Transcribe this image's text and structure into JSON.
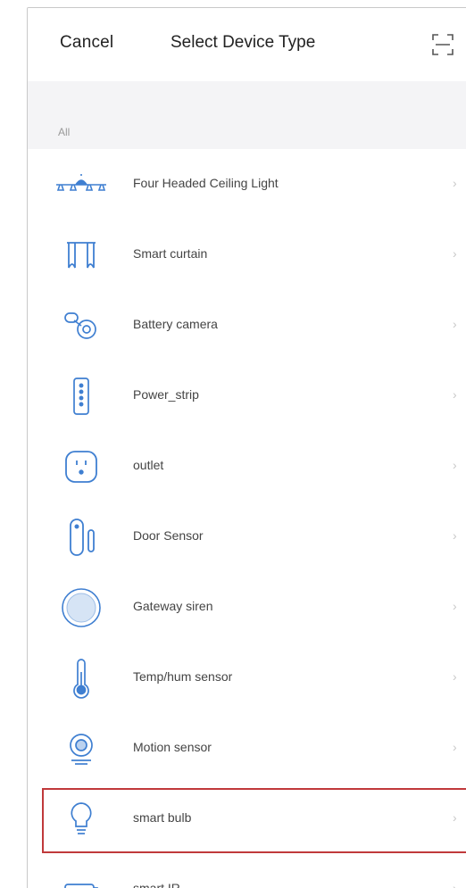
{
  "header": {
    "cancel_label": "Cancel",
    "title": "Select Device Type",
    "scan_icon": "scan-icon"
  },
  "section": {
    "label": "All"
  },
  "devices": [
    {
      "label": "Four Headed Ceiling Light",
      "icon": "ceiling-light-icon"
    },
    {
      "label": "Smart curtain",
      "icon": "curtain-icon"
    },
    {
      "label": "Battery camera",
      "icon": "camera-icon"
    },
    {
      "label": "Power_strip",
      "icon": "power-strip-icon"
    },
    {
      "label": "outlet",
      "icon": "outlet-icon"
    },
    {
      "label": "Door Sensor",
      "icon": "door-sensor-icon"
    },
    {
      "label": "Gateway siren",
      "icon": "siren-icon"
    },
    {
      "label": "Temp/hum sensor",
      "icon": "thermometer-icon"
    },
    {
      "label": "Motion sensor",
      "icon": "motion-sensor-icon"
    },
    {
      "label": "smart bulb",
      "icon": "bulb-icon",
      "highlighted": true
    },
    {
      "label": "smart IR",
      "icon": "ir-remote-icon"
    }
  ],
  "chevron": "›",
  "colors": {
    "icon_blue": "#3f7fd1",
    "highlight_border": "#c0393b",
    "section_bg": "#f4f4f6"
  }
}
